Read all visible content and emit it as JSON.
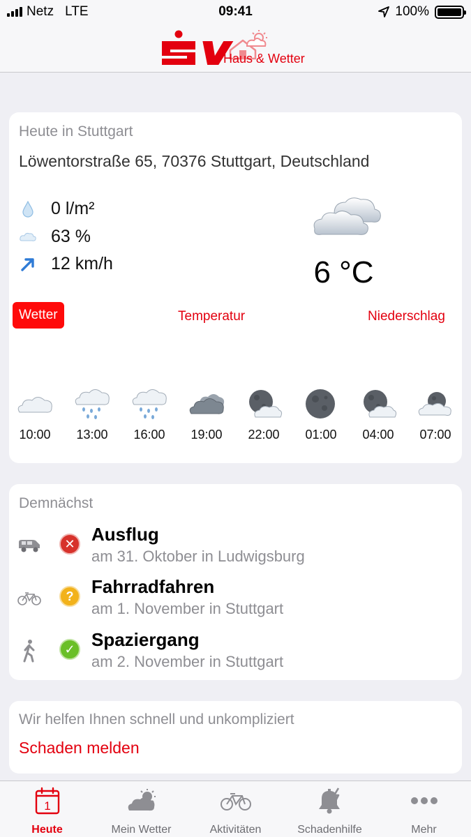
{
  "status_bar": {
    "carrier": "Netz",
    "network": "LTE",
    "time": "09:41",
    "battery": "100%"
  },
  "header": {
    "logo_text": "SV",
    "logo_subtitle": "Haus & Wetter",
    "brand_color": "#e3000f"
  },
  "today": {
    "title": "Heute in Stuttgart",
    "address": "Löwentorstraße 65, 70376 Stuttgart, Deutschland",
    "precipitation": "0 l/m²",
    "humidity": "63 %",
    "wind": "12 km/h",
    "temperature": "6 °C",
    "condition_icon": "cloudy-icon",
    "tabs": [
      {
        "label": "Wetter",
        "active": true
      },
      {
        "label": "Temperatur",
        "active": false
      },
      {
        "label": "Niederschlag",
        "active": false
      }
    ],
    "hourly": [
      {
        "time": "10:00",
        "icon": "cloud-icon"
      },
      {
        "time": "13:00",
        "icon": "rain-icon"
      },
      {
        "time": "16:00",
        "icon": "rain-icon"
      },
      {
        "time": "19:00",
        "icon": "dark-cloud-icon"
      },
      {
        "time": "22:00",
        "icon": "moon-cloud-icon"
      },
      {
        "time": "01:00",
        "icon": "moon-icon"
      },
      {
        "time": "04:00",
        "icon": "moon-cloud-icon"
      },
      {
        "time": "07:00",
        "icon": "moon-cloud-icon"
      }
    ]
  },
  "upcoming": {
    "title": "Demnächst",
    "events": [
      {
        "title": "Ausflug",
        "subtitle": "am 31. Oktober in Ludwigsburg",
        "activity_icon": "car-icon",
        "status": "bad"
      },
      {
        "title": "Fahrradfahren",
        "subtitle": "am 1. November in Stuttgart",
        "activity_icon": "bicycle-icon",
        "status": "uncertain"
      },
      {
        "title": "Spaziergang",
        "subtitle": "am 2. November in Stuttgart",
        "activity_icon": "walking-icon",
        "status": "good"
      }
    ]
  },
  "help": {
    "text": "Wir helfen Ihnen schnell und unkompliziert",
    "link": "Schaden melden"
  },
  "tab_bar": {
    "items": [
      {
        "label": "Heute",
        "icon": "calendar-icon",
        "active": true
      },
      {
        "label": "Mein Wetter",
        "icon": "weather-icon",
        "active": false
      },
      {
        "label": "Aktivitäten",
        "icon": "bicycle-icon",
        "active": false
      },
      {
        "label": "Schadenhilfe",
        "icon": "alarm-bell-icon",
        "active": false
      },
      {
        "label": "Mehr",
        "icon": "more-icon",
        "active": false
      }
    ]
  }
}
